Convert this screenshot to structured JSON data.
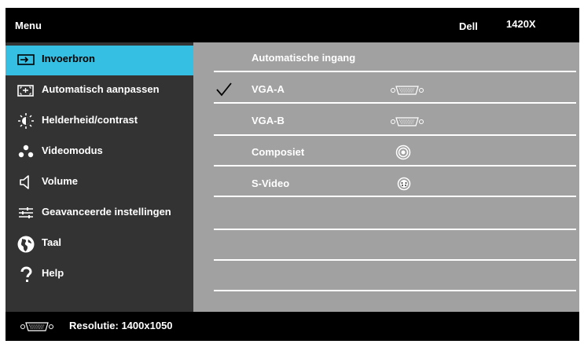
{
  "header": {
    "menu_label": "Menu",
    "brand": "Dell",
    "model": "1420X"
  },
  "sidebar": {
    "items": [
      {
        "label": "Invoerbron",
        "icon": "input-source-icon",
        "active": true
      },
      {
        "label": "Automatisch aanpassen",
        "icon": "auto-adjust-icon",
        "active": false
      },
      {
        "label": "Helderheid/contrast",
        "icon": "brightness-icon",
        "active": false
      },
      {
        "label": "Videomodus",
        "icon": "video-mode-icon",
        "active": false
      },
      {
        "label": "Volume",
        "icon": "volume-icon",
        "active": false
      },
      {
        "label": "Geavanceerde instellingen",
        "icon": "settings-sliders-icon",
        "active": false
      },
      {
        "label": "Taal",
        "icon": "globe-icon",
        "active": false
      },
      {
        "label": "Help",
        "icon": "question-icon",
        "active": false
      }
    ]
  },
  "content": {
    "title": "Automatische ingang",
    "sources": [
      {
        "label": "VGA-A",
        "connector": "vga-connector-icon",
        "selected": true
      },
      {
        "label": "VGA-B",
        "connector": "vga-connector-icon",
        "selected": false
      },
      {
        "label": "Composiet",
        "connector": "rca-connector-icon",
        "selected": false
      },
      {
        "label": "S-Video",
        "connector": "svideo-connector-icon",
        "selected": false
      }
    ]
  },
  "status": {
    "text": "Resolutie: 1400x1050",
    "icon": "vga-connector-icon"
  },
  "colors": {
    "active_highlight": "#35c0e3",
    "sidebar_bg": "#333333",
    "content_bg": "#a1a1a1",
    "frame": "#000000"
  }
}
